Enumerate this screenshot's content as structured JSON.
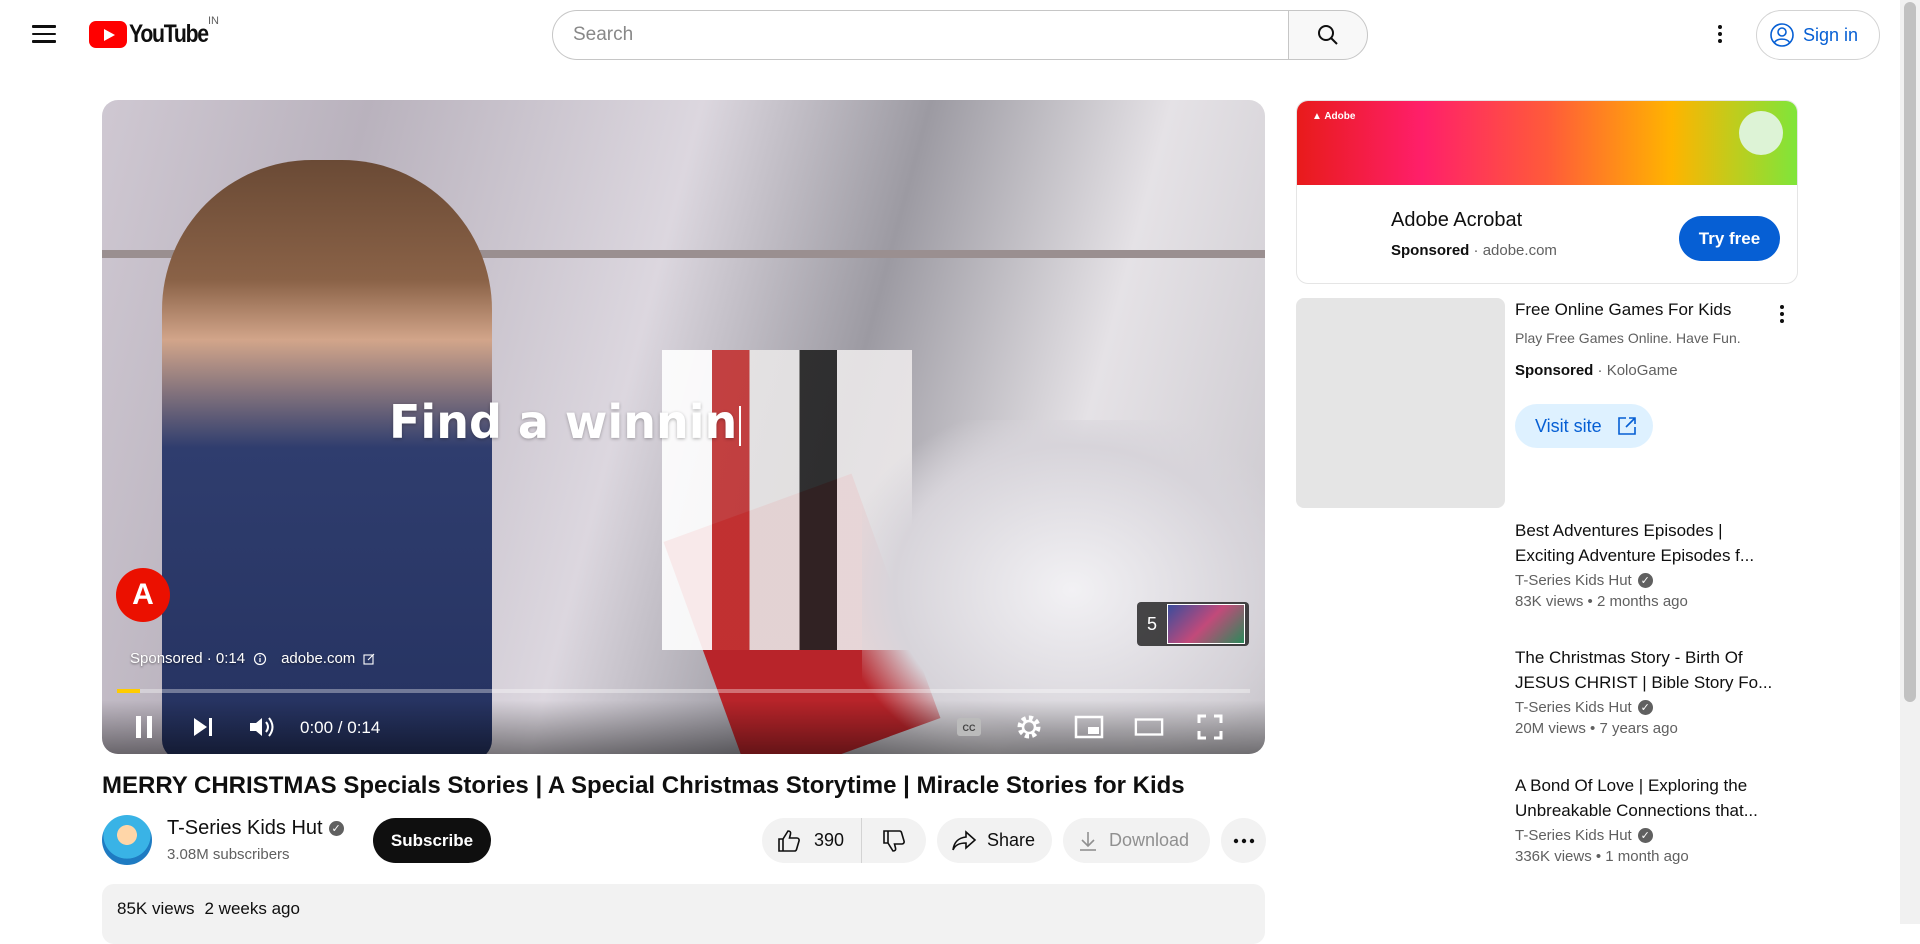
{
  "header": {
    "logo_text": "YouTube",
    "country_code": "IN",
    "search_placeholder": "Search",
    "signin_label": "Sign in"
  },
  "player": {
    "overlay_text": "Find a winnin",
    "ad_logo_letter": "A",
    "ad_sponsored": "Sponsored · 0:14",
    "ad_domain": "adobe.com",
    "next_count": "5",
    "time": "0:00 / 0:14",
    "progress_fraction": 0.02
  },
  "video": {
    "title": "MERRY CHRISTMAS Specials Stories | A Special Christmas Storytime | Miracle Stories for Kids",
    "channel_name": "T-Series Kids Hut",
    "subscribers": "3.08M subscribers",
    "subscribe_label": "Subscribe",
    "like_count": "390",
    "share_label": "Share",
    "download_label": "Download",
    "views": "85K views",
    "posted": "2 weeks ago"
  },
  "ad_card": {
    "banner_brand": "Adobe",
    "title": "Adobe Acrobat",
    "sponsored": "Sponsored",
    "domain": "adobe.com",
    "cta": "Try free"
  },
  "side_ad": {
    "title": "Free Online Games For Kids",
    "description": "Play Free Games Online. Have Fun.",
    "sponsored": "Sponsored",
    "advertiser": "KoloGame",
    "cta": "Visit site"
  },
  "recommendations": [
    {
      "title_line1": "Best Adventures Episodes |",
      "title_line2": "Exciting Adventure Episodes f...",
      "channel": "T-Series Kids Hut",
      "meta": "83K views  • 2 months ago"
    },
    {
      "title_line1": "The Christmas Story - Birth Of",
      "title_line2": "JESUS CHRIST | Bible Story Fo...",
      "channel": "T-Series Kids Hut",
      "meta": "20M views  • 7 years ago"
    },
    {
      "title_line1": "A Bond Of Love | Exploring the",
      "title_line2": "Unbreakable Connections that...",
      "channel": "T-Series Kids Hut",
      "meta": "336K views  • 1 month ago"
    }
  ]
}
